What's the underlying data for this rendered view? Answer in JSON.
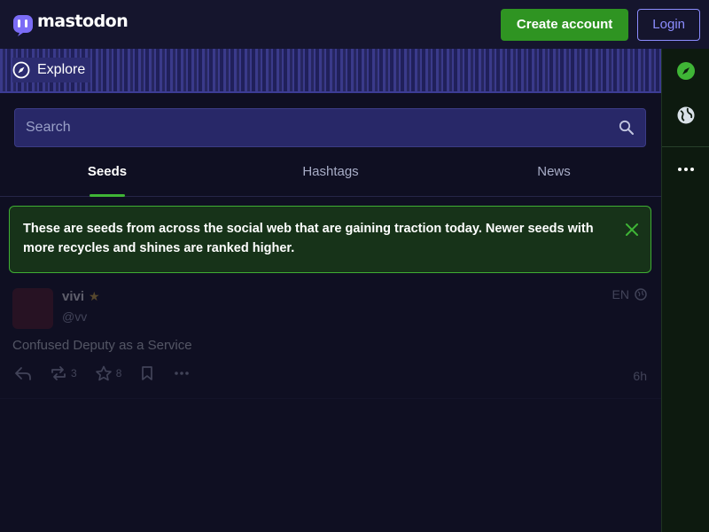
{
  "header": {
    "brand": "mastodon",
    "create_account_label": "Create account",
    "login_label": "Login"
  },
  "explore": {
    "title": "Explore"
  },
  "search": {
    "placeholder": "Search"
  },
  "tabs": [
    {
      "label": "Seeds",
      "active": true
    },
    {
      "label": "Hashtags",
      "active": false
    },
    {
      "label": "News",
      "active": false
    }
  ],
  "notice": {
    "text": "These are seeds from across the social web that are gaining traction today. Newer seeds with more recycles and shines are ranked higher."
  },
  "post": {
    "display_name": "vivi",
    "handle": "@vv",
    "language": "EN",
    "content": "Confused Deputy as a Service",
    "reblog_count": "3",
    "favourite_count": "8",
    "time": "6h"
  },
  "colors": {
    "accent_green": "#2f9422",
    "link_purple": "#8c8dff",
    "notice_border": "#3fae33",
    "background": "#0f0f22"
  },
  "icons": {
    "logo": "mastodon-logo-icon",
    "explore": "compass-icon",
    "search": "search-icon",
    "close": "close-icon",
    "globe": "globe-icon",
    "reply": "reply-icon",
    "reblog": "reblog-icon",
    "favourite": "star-icon",
    "bookmark": "bookmark-icon",
    "more": "ellipsis-icon"
  }
}
